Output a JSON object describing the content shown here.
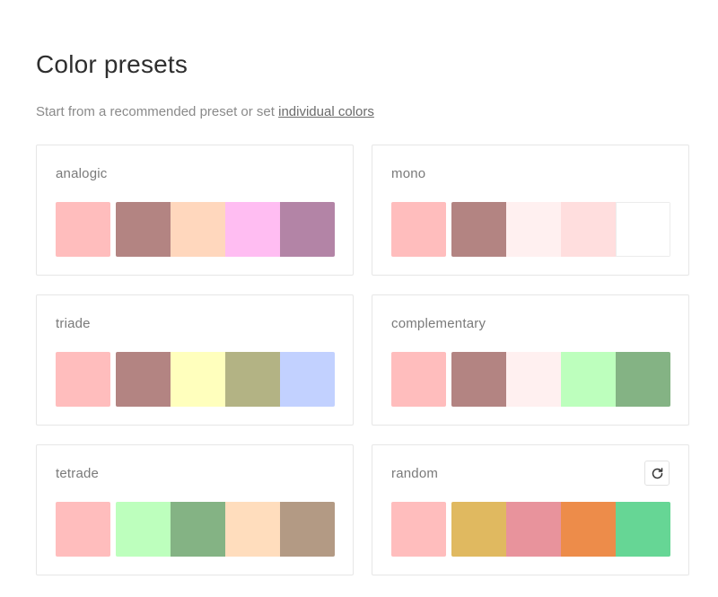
{
  "header": {
    "title": "Color presets",
    "subtitle_prefix": "Start from a recommended preset or set ",
    "subtitle_link": "individual colors"
  },
  "presets": [
    {
      "label": "analogic",
      "base": "#FFBDBD",
      "colors": [
        "#B38482",
        "#FFD7BD",
        "#FFBDF2",
        "#B384A6"
      ]
    },
    {
      "label": "mono",
      "base": "#FFBDBD",
      "colors": [
        "#B38482",
        "#FFF0F0",
        "#FFDEDE",
        "#FFFFFF"
      ]
    },
    {
      "label": "triade",
      "base": "#FFBDBD",
      "colors": [
        "#B38482",
        "#FFFFBD",
        "#B3B384",
        "#C2D1FF"
      ]
    },
    {
      "label": "complementary",
      "base": "#FFBDBD",
      "colors": [
        "#B38482",
        "#FFF0F0",
        "#BDFFBD",
        "#84B384"
      ]
    },
    {
      "label": "tetrade",
      "base": "#FFBDBD",
      "colors": [
        "#BDFFBD",
        "#84B384",
        "#FFDDBD",
        "#B39A84"
      ]
    },
    {
      "label": "random",
      "base": "#FFBDBD",
      "colors": [
        "#E0B960",
        "#E8939C",
        "#ED8C4A",
        "#66D695"
      ],
      "action_icon": "refresh-icon"
    }
  ]
}
